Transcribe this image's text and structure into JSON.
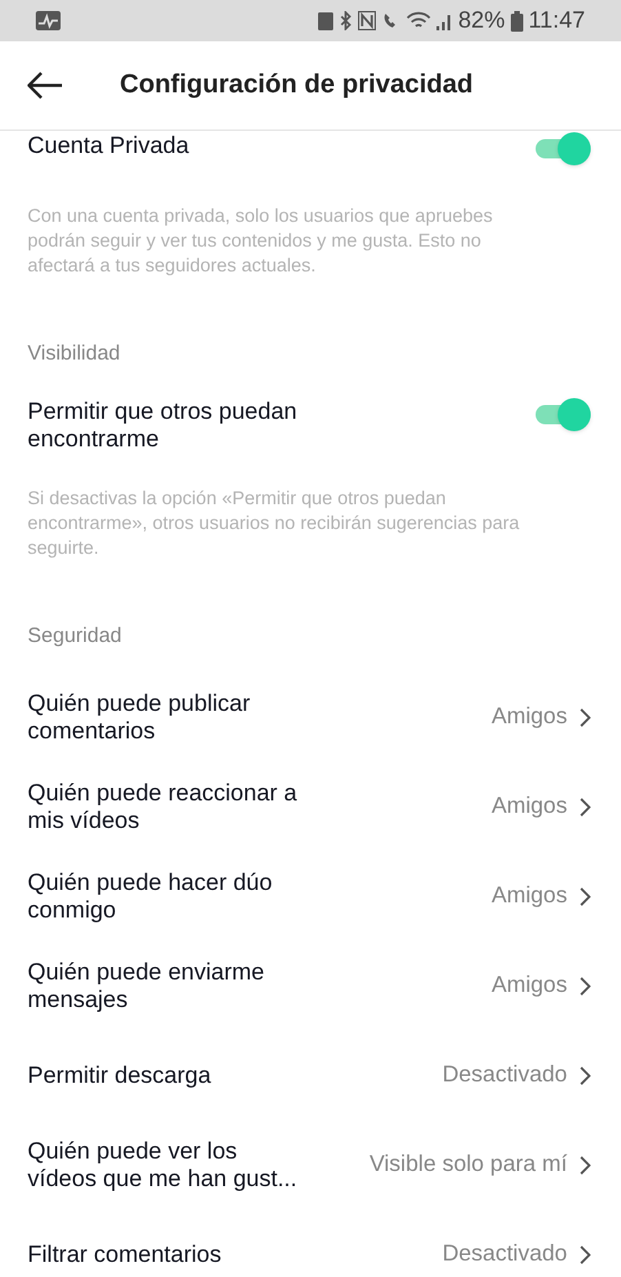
{
  "status_bar": {
    "battery": "82%",
    "time": "11:47"
  },
  "header": {
    "title": "Configuración de privacidad"
  },
  "sections": [
    {
      "items": [
        {
          "kind": "toggle",
          "label": "Cuenta Privada",
          "on": true,
          "description": "Con una cuenta privada, solo los usuarios que apruebes podrán seguir y ver tus contenidos y me gusta. Esto no afectará a tus seguidores actuales."
        }
      ]
    },
    {
      "heading": "Visibilidad",
      "items": [
        {
          "kind": "toggle",
          "label": "Permitir que otros puedan encontrarme",
          "on": true,
          "description": "Si desactivas la opción «Permitir que otros puedan encontrarme», otros usuarios no recibirán sugerencias para seguirte."
        }
      ]
    },
    {
      "heading": "Seguridad",
      "items": [
        {
          "kind": "link",
          "label": "Quién puede publicar comentarios",
          "value": "Amigos"
        },
        {
          "kind": "link",
          "label": "Quién puede reaccionar a mis vídeos",
          "value": "Amigos"
        },
        {
          "kind": "link",
          "label": "Quién puede hacer dúo conmigo",
          "value": "Amigos"
        },
        {
          "kind": "link",
          "label": "Quién puede enviarme mensajes",
          "value": "Amigos"
        },
        {
          "kind": "link",
          "label": "Permitir descarga",
          "value": "Desactivado"
        },
        {
          "kind": "link",
          "label": "Quién puede ver los vídeos que me han gust...",
          "value": "Visible solo para mí"
        },
        {
          "kind": "link",
          "label": "Filtrar comentarios",
          "value": "Desactivado"
        }
      ]
    }
  ]
}
